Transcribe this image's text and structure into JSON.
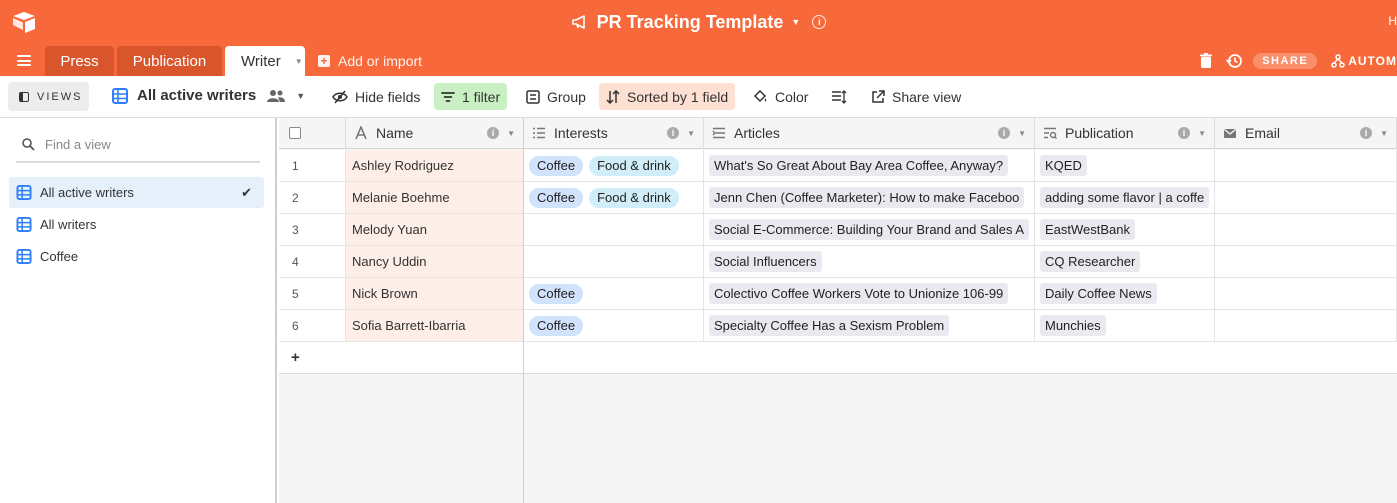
{
  "app": {
    "title": "PR Tracking Template",
    "user_initial": "H",
    "share_label": "SHARE",
    "automations_label": "AUTOM"
  },
  "tabs": [
    {
      "label": "Press",
      "active": false
    },
    {
      "label": "Publication",
      "active": false
    },
    {
      "label": "Writer",
      "active": true
    }
  ],
  "add_import_label": "Add or import",
  "viewbar": {
    "views_label": "VIEWS",
    "current_view": "All active writers",
    "hide_fields": "Hide fields",
    "filter": "1 filter",
    "group": "Group",
    "sorted": "Sorted by 1 field",
    "color": "Color",
    "share_view": "Share view"
  },
  "sidebar": {
    "search_placeholder": "Find a view",
    "items": [
      {
        "label": "All active writers",
        "active": true
      },
      {
        "label": "All writers",
        "active": false
      },
      {
        "label": "Coffee",
        "active": false
      }
    ]
  },
  "columns": [
    "Name",
    "Interests",
    "Articles",
    "Publication",
    "Email"
  ],
  "rows": [
    {
      "num": "1",
      "name": "Ashley Rodriguez",
      "interests": [
        "Coffee",
        "Food & drink"
      ],
      "article": "What's So Great About Bay Area Coffee, Anyway?",
      "publication": "KQED"
    },
    {
      "num": "2",
      "name": "Melanie Boehme",
      "interests": [
        "Coffee",
        "Food & drink"
      ],
      "article": "Jenn Chen (Coffee Marketer): How to make Faceboo",
      "publication": "adding some flavor | a coffe"
    },
    {
      "num": "3",
      "name": "Melody Yuan",
      "interests": [],
      "article": "Social E-Commerce: Building Your Brand and Sales A",
      "publication": "EastWestBank"
    },
    {
      "num": "4",
      "name": "Nancy Uddin",
      "interests": [],
      "article": "Social Influencers",
      "publication": "CQ Researcher"
    },
    {
      "num": "5",
      "name": "Nick Brown",
      "interests": [
        "Coffee"
      ],
      "article": "Colectivo Coffee Workers Vote to Unionize 106-99",
      "publication": "Daily Coffee News"
    },
    {
      "num": "6",
      "name": "Sofia Barrett-Ibarria",
      "interests": [
        "Coffee"
      ],
      "article": "Specialty Coffee Has a Sexism Problem",
      "publication": "Munchies"
    }
  ],
  "colors": {
    "brand": "#f7693a",
    "tab_inactive": "#d9552c",
    "filter_bg": "#c9f0c2",
    "sort_bg": "#fde0d2",
    "pill_blue": "#d0e2fc",
    "pill_cyan": "#cfeef9"
  }
}
